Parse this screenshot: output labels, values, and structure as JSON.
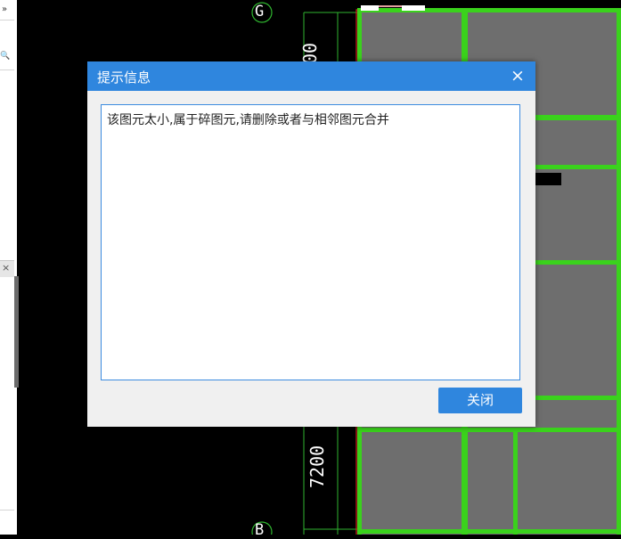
{
  "left_panel": {
    "toolbar_glyph_expand": "»",
    "toolbar_glyph_search": "🔍",
    "panel_close_glyph": "×"
  },
  "cad": {
    "axis_top_label": "G",
    "axis_bottom_label": "B",
    "dim_top": "00",
    "dim_bottom": "7200"
  },
  "dialog": {
    "title": "提示信息",
    "close_icon": "×",
    "message": "该图元太小,属于碎图元,请删除或者与相邻图元合并",
    "close_button_label": "关闭"
  },
  "colors": {
    "dialog_title_bg": "#2f86de",
    "button_bg": "#2f86de",
    "cad_bg": "#000000",
    "slab_fill": "#6e6e6e",
    "beam_green": "#3ad21c"
  }
}
